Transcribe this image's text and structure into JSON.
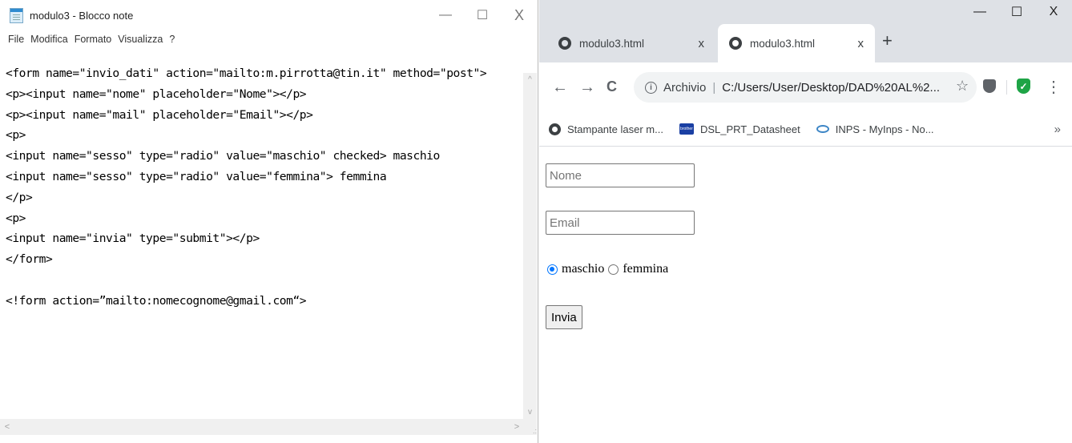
{
  "notepad": {
    "title": "modulo3 - Blocco note",
    "window_buttons": {
      "minimize": "—",
      "maximize": "☐",
      "close": "X"
    },
    "menu": [
      "File",
      "Modifica",
      "Formato",
      "Visualizza",
      "?"
    ],
    "lines": [
      "<form name=\"invio_dati\" action=\"mailto:m.pirrotta@tin.it\" method=\"post\">",
      "<p><input name=\"nome\" placeholder=\"Nome\"></p>",
      "<p><input name=\"mail\" placeholder=\"Email\"></p>",
      "<p>",
      "<input name=\"sesso\" type=\"radio\" value=\"maschio\" checked> maschio",
      "<input name=\"sesso\" type=\"radio\" value=\"femmina\"> femmina",
      "</p>",
      "<p>",
      "<input name=\"invia\" type=\"submit\"></p>",
      "</form>",
      "",
      "<!form action=”mailto:nomecognome@gmail.com“>"
    ]
  },
  "browser": {
    "tabs": [
      {
        "title": "modulo3.html",
        "close": "x"
      },
      {
        "title": "modulo3.html",
        "close": "x"
      }
    ],
    "new_tab": "+",
    "window_buttons": {
      "minimize": "—",
      "maximize": "☐",
      "close": "X"
    },
    "nav": {
      "back": "←",
      "forward": "→",
      "reload": "C"
    },
    "omnibox": {
      "security_label": "Archivio",
      "separator": "|",
      "url": "C:/Users/User/Desktop/DAD%20AL%2..."
    },
    "star": "☆",
    "menu": "⋮",
    "bookmarks": [
      {
        "label": "Stampante laser m...",
        "icon": "globe-icon"
      },
      {
        "label": "DSL_PRT_Datasheet",
        "icon": "brother-icon"
      },
      {
        "label": "INPS - MyInps - No...",
        "icon": "inps-icon"
      }
    ],
    "bookmarks_more": "»",
    "page": {
      "name_placeholder": "Nome",
      "email_placeholder": "Email",
      "radio_options": [
        "maschio",
        "femmina"
      ],
      "selected": "maschio",
      "submit_label": "Invia"
    }
  }
}
